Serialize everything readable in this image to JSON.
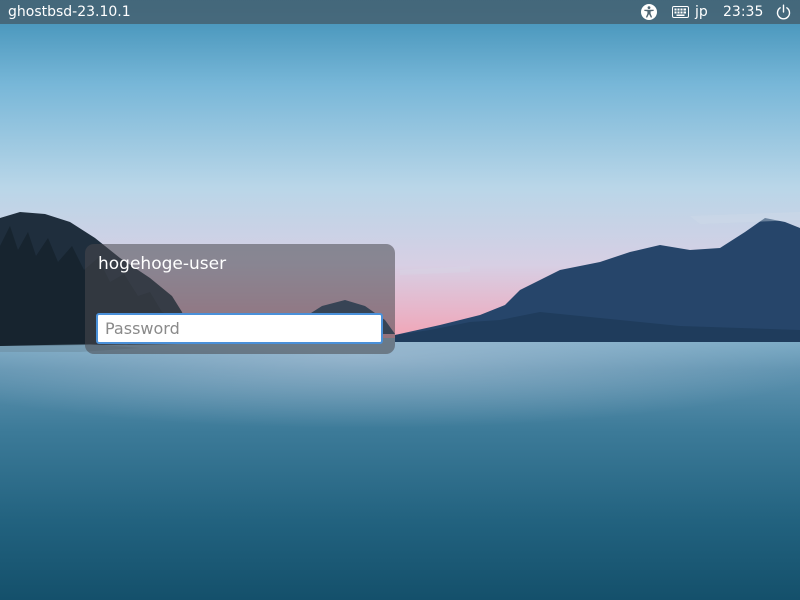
{
  "top_panel": {
    "hostname": "ghostbsd-23.10.1",
    "keyboard_layout": "jp",
    "clock": "23:35",
    "icons": {
      "accessibility": "accessibility-icon",
      "keyboard": "keyboard-icon",
      "power": "power-icon"
    }
  },
  "login": {
    "username": "hogehoge-user",
    "password_placeholder": "Password",
    "password_value": ""
  },
  "colors": {
    "focus_border": "#4a90d9",
    "panel_bg": "#465f6e",
    "sky_top": "#3b8db4",
    "sky_horizon": "#ddb6cc",
    "water": "#1a5a78"
  }
}
